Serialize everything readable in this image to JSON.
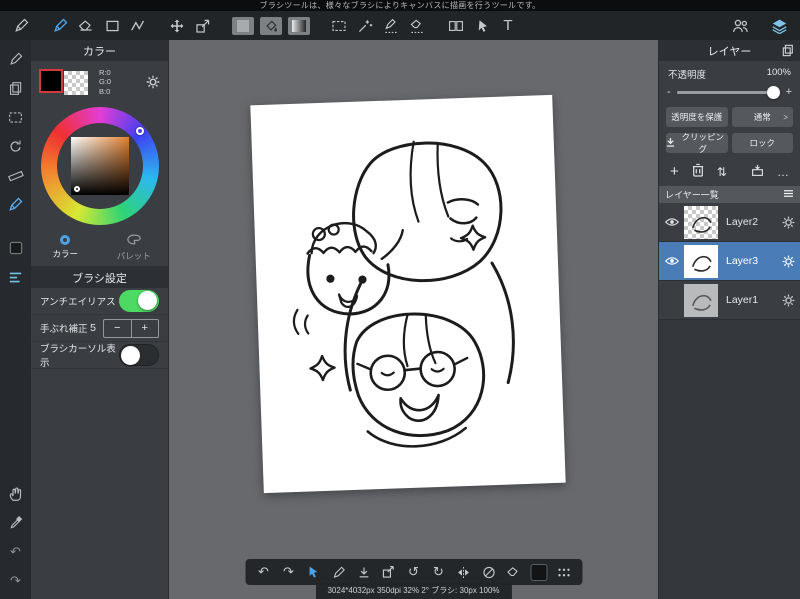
{
  "app": {
    "tooltip": "ブラシツールは、様々なブラシによりキャンバスに描画を行うツールです。",
    "text_tool_label": "T"
  },
  "color_panel": {
    "title": "カラー",
    "rgb_r": "R:0",
    "rgb_g": "G:0",
    "rgb_b": "B:0",
    "tab_color": "カラー",
    "tab_palette": "パレット"
  },
  "brush_panel": {
    "title": "ブラシ設定",
    "antialias": "アンチエイリアス",
    "antialias_on": true,
    "stabilization": "手ぶれ補正",
    "stabilization_value": "5",
    "minus": "−",
    "plus": "+",
    "cursor_display": "ブラシカーソル表示",
    "cursor_display_on": false
  },
  "layer_panel": {
    "title": "レイヤー",
    "opacity_label": "不透明度",
    "opacity_value": "100%",
    "slider_minus": "-",
    "slider_plus": "+",
    "protect_alpha": "透明度を保護",
    "blend_mode": "通常",
    "blend_chevron": ">",
    "clipping": "クリッピング",
    "lock": "ロック",
    "list_title": "レイヤー一覧",
    "layers": [
      {
        "name": "Layer2",
        "visible": true,
        "selected": false
      },
      {
        "name": "Layer3",
        "visible": true,
        "selected": true
      },
      {
        "name": "Layer1",
        "visible": false,
        "selected": false
      }
    ]
  },
  "statusbar": {
    "text": "3024*4032px 350dpi 32% 2° ブラシ: 30px 100%"
  },
  "colors": {
    "accent": "#4da3e8",
    "toggle_on": "#4cd964",
    "selected_layer_bg": "#4a7db8",
    "primary_color": "#000000"
  }
}
